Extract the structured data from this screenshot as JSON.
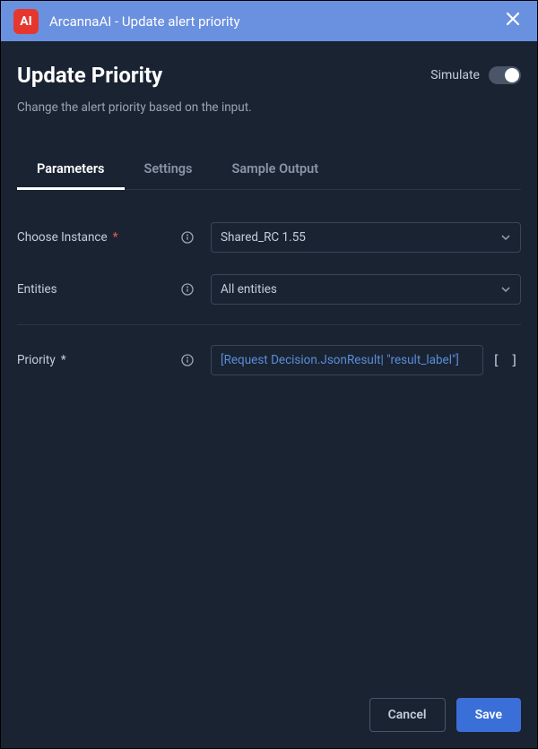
{
  "titlebar": {
    "app_icon_text": "AI",
    "title": "ArcannaAI - Update alert priority"
  },
  "header": {
    "title": "Update Priority",
    "simulate_label": "Simulate",
    "subtitle": "Change the alert priority based on the input."
  },
  "tabs": [
    {
      "label": "Parameters",
      "active": true
    },
    {
      "label": "Settings",
      "active": false
    },
    {
      "label": "Sample Output",
      "active": false
    }
  ],
  "form": {
    "instance": {
      "label": "Choose Instance",
      "required": true,
      "value": "Shared_RC 1.55"
    },
    "entities": {
      "label": "Entities",
      "required": false,
      "value": "All entities"
    },
    "priority": {
      "label": "Priority",
      "required": true,
      "value": "[Request Decision.JsonResult| \"result_label\"]",
      "placeholder_btn": "[ ]"
    }
  },
  "footer": {
    "cancel": "Cancel",
    "save": "Save"
  }
}
